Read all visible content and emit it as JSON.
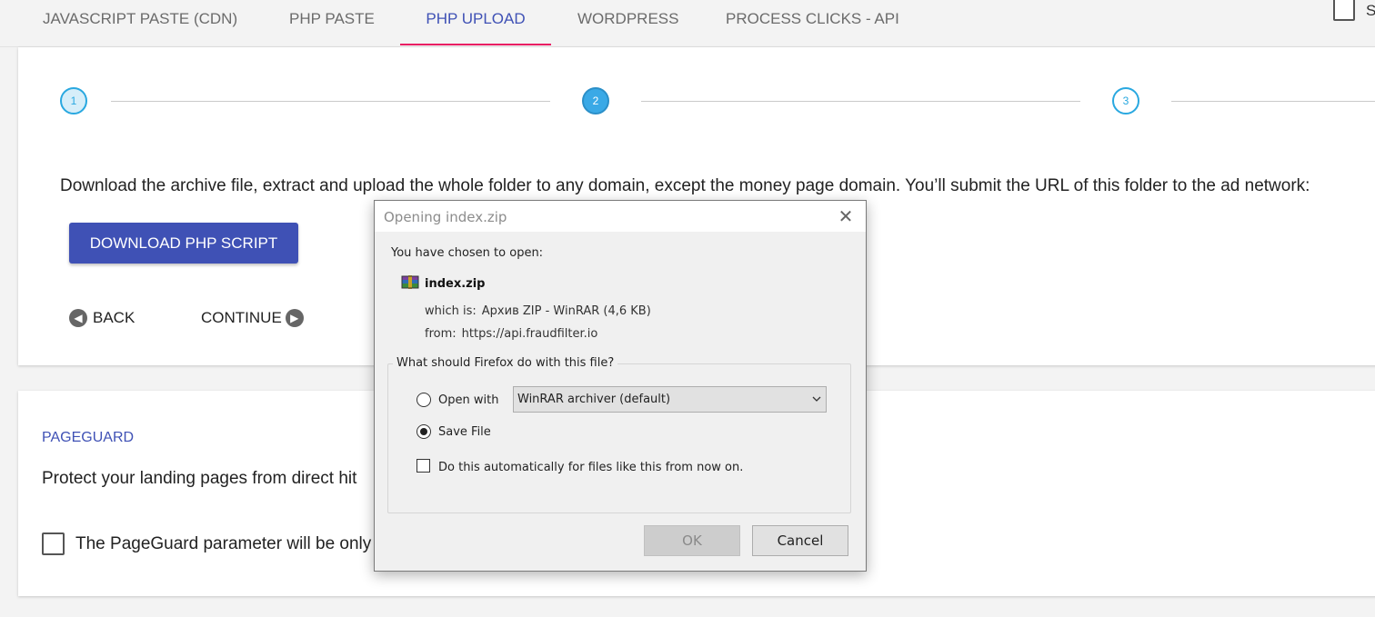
{
  "tabs": [
    {
      "label": "JAVASCRIPT PASTE (CDN)"
    },
    {
      "label": "PHP PASTE"
    },
    {
      "label": "PHP UPLOAD"
    },
    {
      "label": "WORDPRESS"
    },
    {
      "label": "PROCESS CLICKS - API"
    }
  ],
  "corner": {
    "letter": "S"
  },
  "stepper": {
    "steps": [
      "1",
      "2",
      "3"
    ]
  },
  "upload": {
    "instruction": "Download the archive file, extract and upload the whole folder to any domain, except the money page domain. You’ll submit the URL of this folder to the ad network:",
    "download_label": "DOWNLOAD PHP SCRIPT",
    "back_label": "BACK",
    "continue_label": "CONTINUE"
  },
  "pageguard": {
    "title": "PAGEGUARD",
    "text": "Protect your landing pages from direct hit",
    "checkbox_label": "The PageGuard parameter will be only"
  },
  "dialog": {
    "title": "Opening index.zip",
    "chosen": "You have chosen to open:",
    "filename": "index.zip",
    "which_label": "which is:",
    "which_value": "Архив ZIP - WinRAR (4,6 KB)",
    "from_label": "from:",
    "from_value": "https://api.fraudfilter.io",
    "group_title": "What should Firefox do with this file?",
    "open_with_label": "Open with",
    "open_with_app": "WinRAR archiver (default)",
    "save_label": "Save File",
    "auto_label": "Do this automatically for files like this from now on.",
    "ok_label": "OK",
    "cancel_label": "Cancel"
  }
}
